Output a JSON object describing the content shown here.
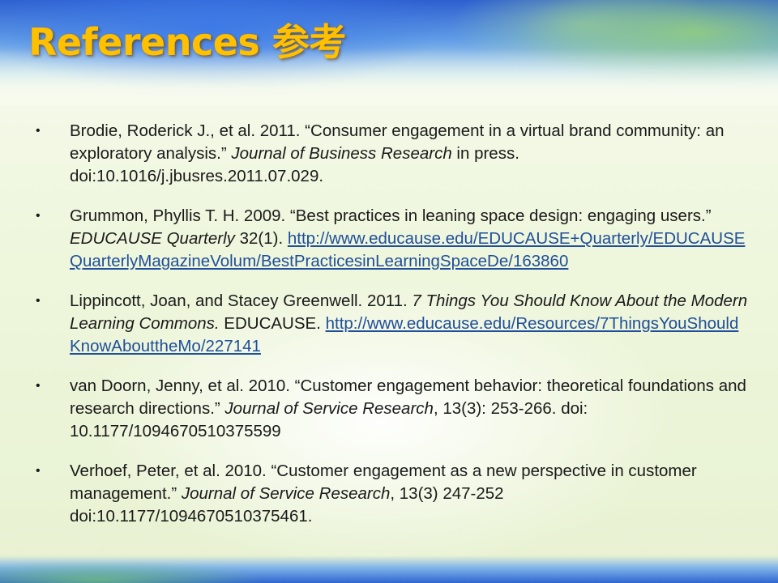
{
  "slide": {
    "title": "References 参考",
    "bullet_glyph": "•",
    "references": [
      {
        "before": "Brodie, Roderick J., et al. 2011. “Consumer engagement in a virtual brand community: an exploratory analysis.” ",
        "italic": "Journal of Business Research",
        "after": " in press. doi:10.1016/j.jbusres.2011.07.029.",
        "link": ""
      },
      {
        "before": "Grummon, Phyllis T. H. 2009.  “Best practices in leaning space design: engaging users.” ",
        "italic": "EDUCAUSE Quarterly",
        "after": " 32(1). ",
        "link": "http://www.educause.edu/EDUCAUSE+Quarterly/EDUCAUSEQuarterlyMagazineVolum/BestPracticesinLearningSpaceDe/163860"
      },
      {
        "before": "Lippincott, Joan, and Stacey Greenwell. 2011. ",
        "italic": "7 Things You Should Know About the Modern Learning Commons.",
        "after": " EDUCAUSE. ",
        "link": "http://www.educause.edu/Resources/7ThingsYouShouldKnowAbouttheMo/227141"
      },
      {
        "before": "van Doorn, Jenny, et al. 2010. “Customer engagement behavior: theoretical foundations and research directions.” ",
        "italic": "Journal of Service Research",
        "after": ", 13(3): 253-266. doi: 10.1177/1094670510375599",
        "link": ""
      },
      {
        "before": "Verhoef, Peter, et al. 2010. “Customer engagement as a new perspective in customer management.” ",
        "italic": "Journal of Service Research",
        "after": ", 13(3) 247-252 doi:10.1177/1094670510375461.",
        "link": ""
      }
    ]
  }
}
